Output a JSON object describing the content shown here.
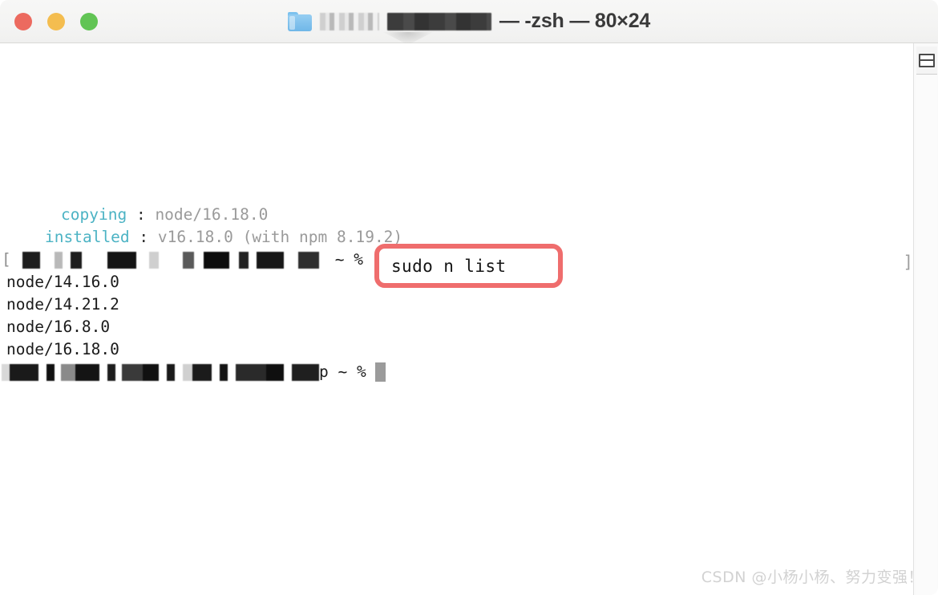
{
  "window": {
    "titlebar": {
      "traffic_lights": [
        {
          "name": "close",
          "color": "#ec6a5f"
        },
        {
          "name": "minimize",
          "color": "#f4bd4f"
        },
        {
          "name": "maximize",
          "color": "#61c454"
        }
      ],
      "folder_icon": "folder-icon",
      "redacted_folder_name": "",
      "title_suffix": "— -zsh — 80×24",
      "shell": "-zsh",
      "size": "80×24"
    },
    "toolbar": {
      "split_pane_icon": "split-pane-icon"
    }
  },
  "terminal": {
    "lines": [
      {
        "id": "copying",
        "key": "copying",
        "colon": ":",
        "value": "node/16.18.0"
      },
      {
        "id": "installed",
        "key": "installed",
        "colon": ":",
        "value": "v16.18.0 (with npm 8.19.2)"
      },
      {
        "id": "prompt-command",
        "open_bracket": "[",
        "redacted": true,
        "prompt_tail": "~ %",
        "close_bracket": "]"
      },
      {
        "id": "node-1",
        "text": "node/14.16.0"
      },
      {
        "id": "node-2",
        "text": "node/14.21.2"
      },
      {
        "id": "node-3",
        "text": "node/16.8.0"
      },
      {
        "id": "node-4",
        "text": "node/16.18.0"
      },
      {
        "id": "prompt-final",
        "redacted": true,
        "prompt_tail": "p ~ %",
        "cursor": true
      }
    ],
    "colors": {
      "key": "#4cb3c4",
      "value": "#9a9a9a",
      "text": "#1b1b1b",
      "cursor": "#9b9b9b"
    }
  },
  "callout": {
    "command": "sudo n list",
    "border_color": "#ef6d6d"
  },
  "watermark": {
    "text": "CSDN @小杨小杨、努力变强！"
  }
}
